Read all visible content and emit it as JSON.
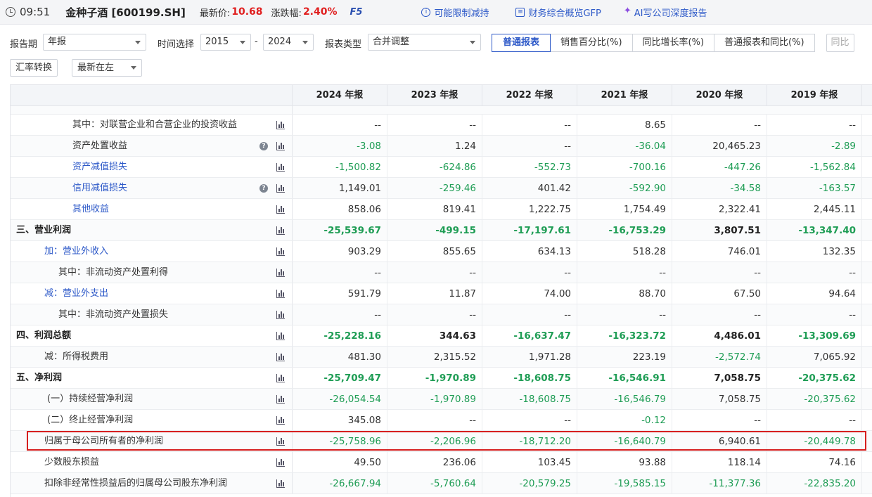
{
  "topbar": {
    "time": "09:51",
    "stock": "金种子酒 [600199.SH]",
    "price_label": "最新价:",
    "price": "10.68",
    "change_label": "涨跌幅:",
    "change": "2.40%",
    "f5": "F5",
    "link_reduction": "可能限制减持",
    "link_gfp": "财务综合概览GFP",
    "link_ai": "AI写公司深度报告"
  },
  "filters": {
    "period_label": "报告期",
    "period_value": "年报",
    "time_label": "时间选择",
    "time_from": "2015",
    "time_sep": "-",
    "time_to": "2024",
    "type_label": "报表类型",
    "type_value": "合并调整",
    "tabs": [
      "普通报表",
      "销售百分比(%)",
      "同比增长率(%)",
      "普通报表和同比(%)",
      "同比"
    ]
  },
  "row2": {
    "fx_button": "汇率转换",
    "order_value": "最新在左"
  },
  "table": {
    "years": [
      "2024 年报",
      "2023 年报",
      "2022 年报",
      "2021 年报",
      "2020 年报",
      "2019 年报"
    ],
    "rows": [
      {
        "label": "其中：对联营企业和合营企业的投资收益",
        "values": [
          "--",
          "--",
          "--",
          "8.65",
          "--",
          "--"
        ]
      },
      {
        "label": "资产处置收益",
        "values": [
          "-3.08",
          "1.24",
          "--",
          "-36.04",
          "20,465.23",
          "-2.89"
        ]
      },
      {
        "label": "资产减值损失",
        "values": [
          "-1,500.82",
          "-624.86",
          "-552.73",
          "-700.16",
          "-447.26",
          "-1,562.84"
        ]
      },
      {
        "label": "信用减值损失",
        "values": [
          "1,149.01",
          "-259.46",
          "401.42",
          "-592.90",
          "-34.58",
          "-163.57"
        ]
      },
      {
        "label": "其他收益",
        "values": [
          "858.06",
          "819.41",
          "1,222.75",
          "1,754.49",
          "2,322.41",
          "2,445.11"
        ]
      },
      {
        "label": "三、营业利润",
        "values": [
          "-25,539.67",
          "-499.15",
          "-17,197.61",
          "-16,753.29",
          "3,807.51",
          "-13,347.40"
        ]
      },
      {
        "label": "加：营业外收入",
        "values": [
          "903.29",
          "855.65",
          "634.13",
          "518.28",
          "746.01",
          "132.35"
        ]
      },
      {
        "label": "其中：非流动资产处置利得",
        "values": [
          "--",
          "--",
          "--",
          "--",
          "--",
          "--"
        ]
      },
      {
        "label": "减：营业外支出",
        "values": [
          "591.79",
          "11.87",
          "74.00",
          "88.70",
          "67.50",
          "94.64"
        ]
      },
      {
        "label": "其中：非流动资产处置损失",
        "values": [
          "--",
          "--",
          "--",
          "--",
          "--",
          "--"
        ]
      },
      {
        "label": "四、利润总额",
        "values": [
          "-25,228.16",
          "344.63",
          "-16,637.47",
          "-16,323.72",
          "4,486.01",
          "-13,309.69"
        ]
      },
      {
        "label": "减：所得税费用",
        "values": [
          "481.30",
          "2,315.52",
          "1,971.28",
          "223.19",
          "-2,572.74",
          "7,065.92"
        ]
      },
      {
        "label": "五、净利润",
        "values": [
          "-25,709.47",
          "-1,970.89",
          "-18,608.75",
          "-16,546.91",
          "7,058.75",
          "-20,375.62"
        ]
      },
      {
        "label": "(一）持续经营净利润",
        "values": [
          "-26,054.54",
          "-1,970.89",
          "-18,608.75",
          "-16,546.79",
          "7,058.75",
          "-20,375.62"
        ]
      },
      {
        "label": "(二）终止经营净利润",
        "values": [
          "345.08",
          "--",
          "--",
          "-0.12",
          "--",
          "--"
        ]
      },
      {
        "label": "归属于母公司所有者的净利润",
        "values": [
          "-25,758.96",
          "-2,206.96",
          "-18,712.20",
          "-16,640.79",
          "6,940.61",
          "-20,449.78"
        ]
      },
      {
        "label": "少数股东损益",
        "values": [
          "49.50",
          "236.06",
          "103.45",
          "93.88",
          "118.14",
          "74.16"
        ]
      },
      {
        "label": "扣除非经常性损益后的归属母公司股东净利润",
        "values": [
          "-26,667.94",
          "-5,760.64",
          "-20,579.25",
          "-19,585.15",
          "-11,377.36",
          "-22,835.20"
        ]
      }
    ]
  }
}
